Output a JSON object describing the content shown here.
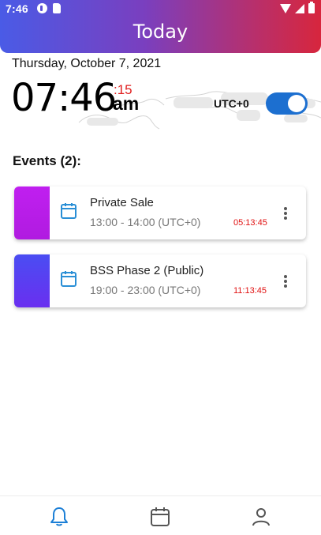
{
  "status_bar": {
    "time": "7:46",
    "icons": [
      "p-app-icon",
      "sd-card-icon",
      "wifi-icon",
      "signal-icon",
      "battery-icon"
    ]
  },
  "header": {
    "title": "Today"
  },
  "clock": {
    "date": "Thursday, October 7, 2021",
    "hours_minutes": "07:46",
    "seconds": ":15",
    "ampm": "am",
    "timezone_label": "UTC+0",
    "timezone_toggle_on": true
  },
  "events": {
    "heading": "Events (2):",
    "items": [
      {
        "title": "Private Sale",
        "time": "13:00 - 14:00 (UTC+0)",
        "countdown": "05:13:45",
        "accent": "#b81fe6"
      },
      {
        "title": "BSS Phase 2 (Public)",
        "time": "19:00 - 23:00 (UTC+0)",
        "countdown": "11:13:45",
        "accent": "#5a3cf0"
      }
    ]
  },
  "bottom_nav": {
    "items": [
      {
        "icon": "bell-icon",
        "active": true
      },
      {
        "icon": "calendar-icon",
        "active": false
      },
      {
        "icon": "user-icon",
        "active": false
      }
    ]
  },
  "colors": {
    "header_gradient_start": "#4a5be6",
    "header_gradient_end": "#d7263d",
    "accent_blue": "#1c6fd0",
    "countdown_red": "#e01010"
  }
}
